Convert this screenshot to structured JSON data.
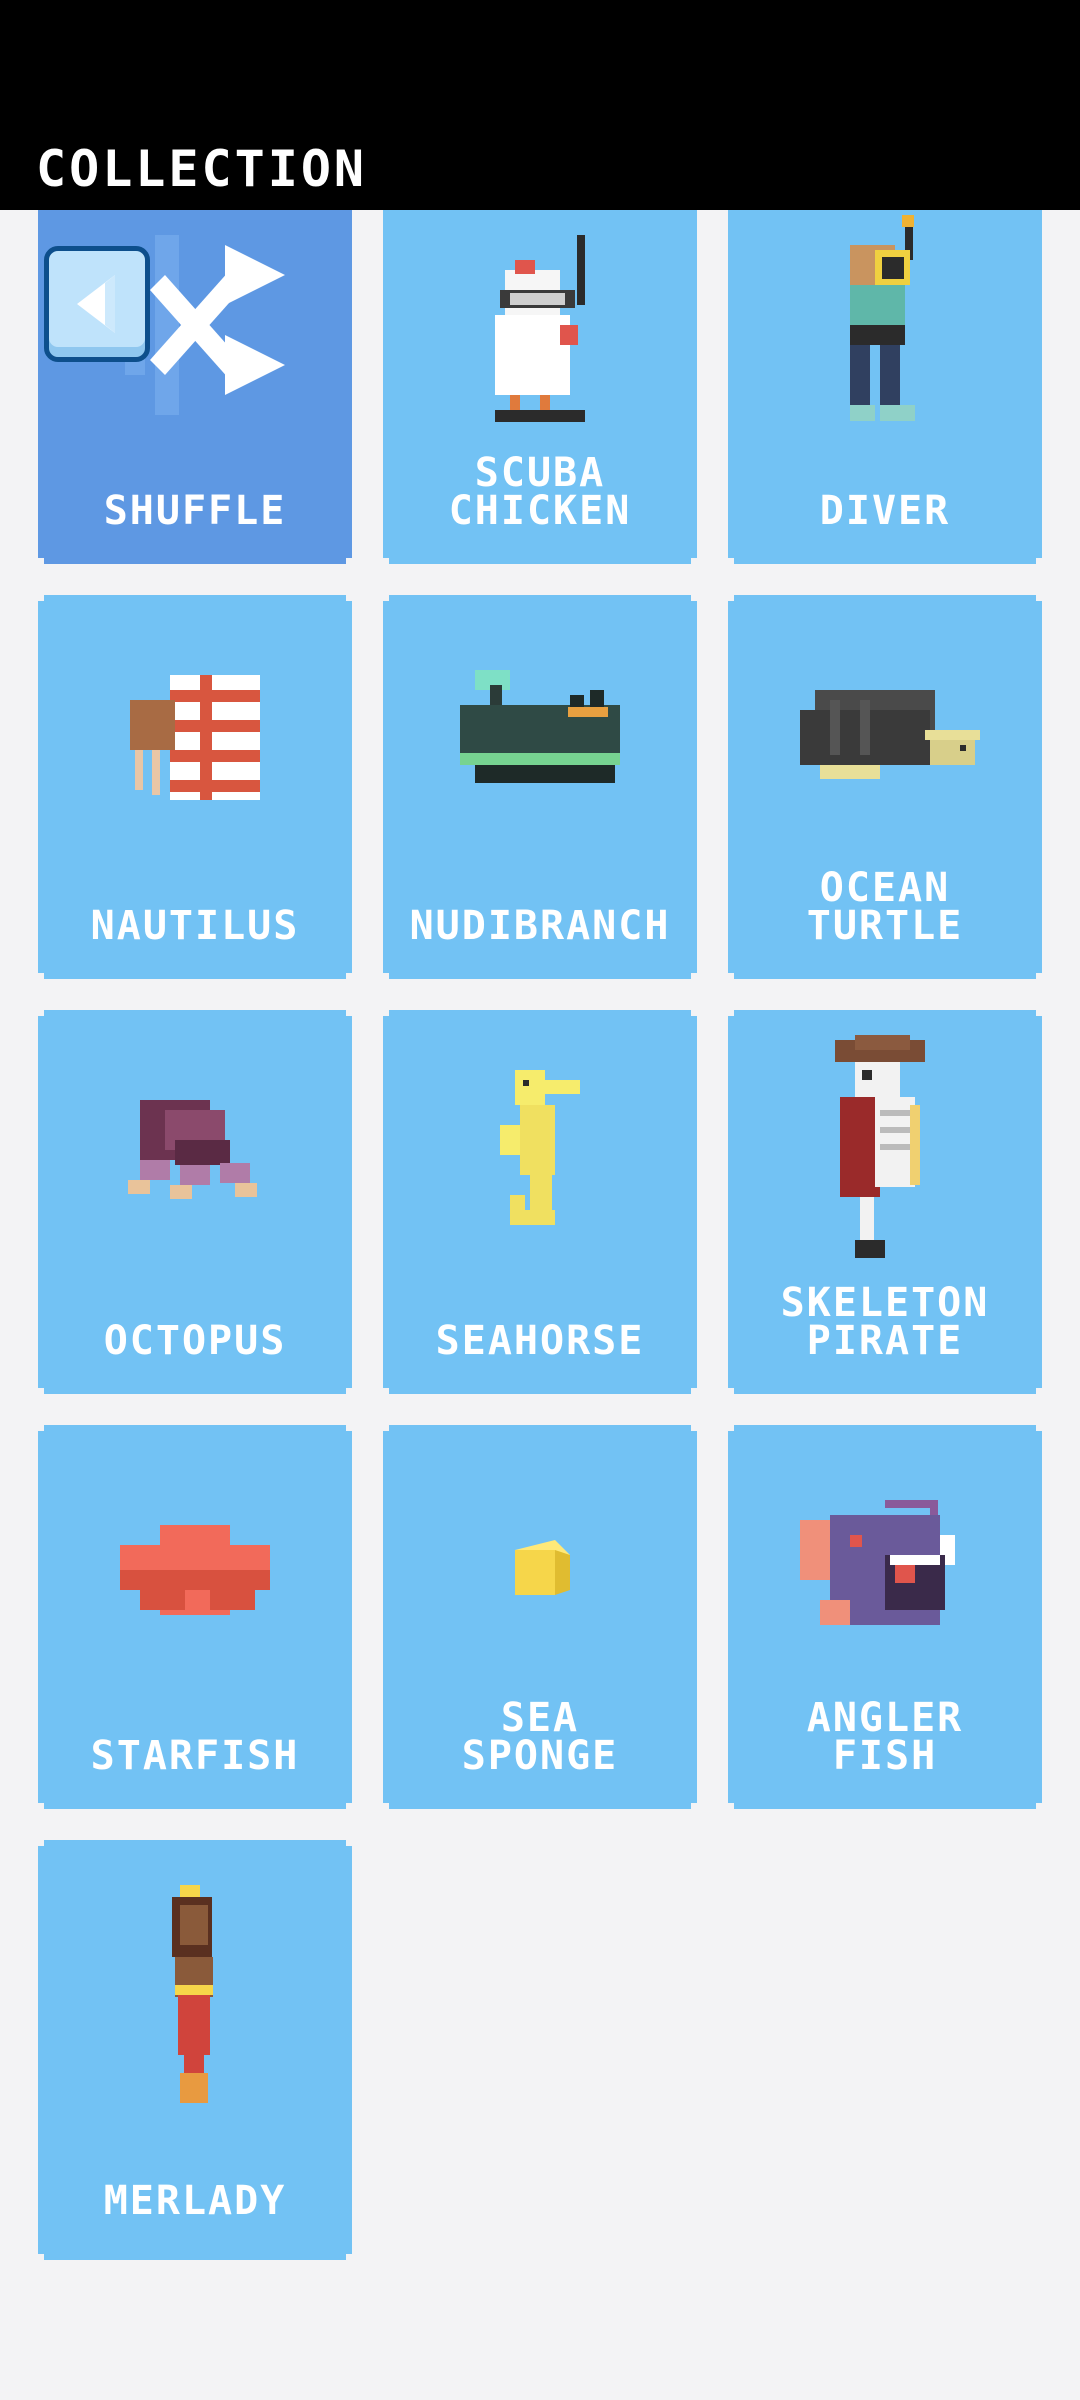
{
  "header": {
    "title": "COLLECTION"
  },
  "items": [
    {
      "label": "SHUFFLE",
      "icon": "shuffle-icon"
    },
    {
      "label": "SCUBA\nCHICKEN",
      "icon": "scuba-chicken-icon"
    },
    {
      "label": "DIVER",
      "icon": "diver-icon"
    },
    {
      "label": "NAUTILUS",
      "icon": "nautilus-icon"
    },
    {
      "label": "NUDIBRANCH",
      "icon": "nudibranch-icon"
    },
    {
      "label": "OCEAN\nTURTLE",
      "icon": "ocean-turtle-icon"
    },
    {
      "label": "OCTOPUS",
      "icon": "octopus-icon"
    },
    {
      "label": "SEAHORSE",
      "icon": "seahorse-icon"
    },
    {
      "label": "SKELETON\nPIRATE",
      "icon": "skeleton-pirate-icon"
    },
    {
      "label": "STARFISH",
      "icon": "starfish-icon"
    },
    {
      "label": "SEA\nSPONGE",
      "icon": "sea-sponge-icon"
    },
    {
      "label": "ANGLER\nFISH",
      "icon": "angler-fish-icon"
    },
    {
      "label": "MERLADY",
      "icon": "merlady-icon"
    }
  ],
  "colors": {
    "card": "#72c2f4",
    "shuffle_card": "#5e98e3",
    "header": "#000000",
    "background": "#f3f3f5"
  }
}
